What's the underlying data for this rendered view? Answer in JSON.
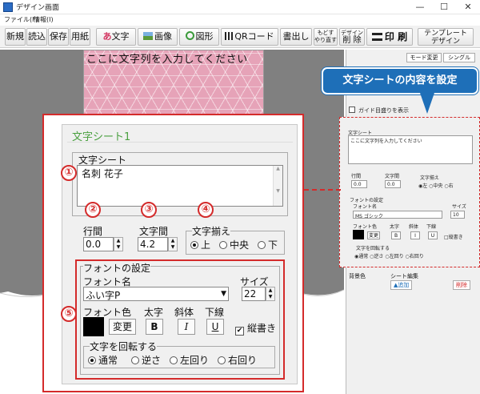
{
  "window": {
    "title": "デザイン画面"
  },
  "menu": [
    "ファイル(F)",
    "情報(I)"
  ],
  "toolbar": {
    "buttons": [
      "新規",
      "読込",
      "保存",
      "用紙"
    ],
    "text": "文字",
    "image": "画像",
    "shape": "図形",
    "qr": "QRコード",
    "write": "書出し",
    "undo_line1": "もどす",
    "undo_line2": "やり直す",
    "design_line1": "デザイン",
    "design_line2": "削 除",
    "print": "印 刷",
    "template_line1": "テンプレート",
    "template_line2": "デザイン"
  },
  "canvas": {
    "text": "ここに文字列を入力してください"
  },
  "side_panel": {
    "tabs": [
      "モード変更",
      "シングル"
    ],
    "guide_check": "ガイド目盛りを表示",
    "bottom_labels": [
      "背景色",
      "シート編集",
      "削除"
    ],
    "add_button": "追加"
  },
  "callout": "文字シートの内容を設定",
  "dialog": {
    "title": "文字シート1",
    "text_group": "文字シート",
    "text_value": "名刺 花子",
    "line_spacing_label": "行間",
    "line_spacing_value": "0.0",
    "char_spacing_label": "文字間",
    "char_spacing_value": "4.2",
    "align_label": "文字揃え",
    "align_options": [
      "上",
      "中央",
      "下"
    ],
    "font_group": "フォントの設定",
    "font_name_label": "フォント名",
    "font_name_value": "ふい字P",
    "size_label": "サイズ",
    "size_value": "22",
    "color_label": "フォント色",
    "change_button": "変更",
    "bold_label": "太字",
    "bold_button": "B",
    "italic_label": "斜体",
    "italic_button": "I",
    "underline_label": "下線",
    "underline_button": "U",
    "vertical_label": "縦書き",
    "rotate_label": "文字を回転する",
    "rotate_options": [
      "通常",
      "逆さ",
      "左回り",
      "右回り"
    ]
  },
  "mini": {
    "text_group": "文字シート",
    "text_value": "ここに文字列を入力してください",
    "line_spacing_label": "行間",
    "line_spacing_value": "0.0",
    "char_spacing_label": "文字間",
    "char_spacing_value": "0.0",
    "align_label": "文字揃え",
    "align_options": [
      "左",
      "中央",
      "右"
    ],
    "font_group": "フォントの設定",
    "font_name_label": "フォント名",
    "font_name_value": "MS ゴシック",
    "size_label": "サイズ",
    "size_value": "10",
    "color_label": "フォント色",
    "bold_label": "太字",
    "italic_label": "斜体",
    "underline_label": "下線",
    "change_button": "変更",
    "bold_button": "B",
    "italic_button": "I",
    "underline_button": "U",
    "vertical_label": "縦書き",
    "rotate_label": "文字を回転する",
    "rotate_options": [
      "通常",
      "逆さ",
      "左回り",
      "右回り"
    ]
  },
  "markers": [
    "①",
    "②",
    "③",
    "④",
    "⑤"
  ],
  "colors": {
    "accent_red": "#d42b2b",
    "callout_blue": "#1e6fb8",
    "title_green": "#4aa040",
    "canvas_pink": "#e6a3b8"
  }
}
